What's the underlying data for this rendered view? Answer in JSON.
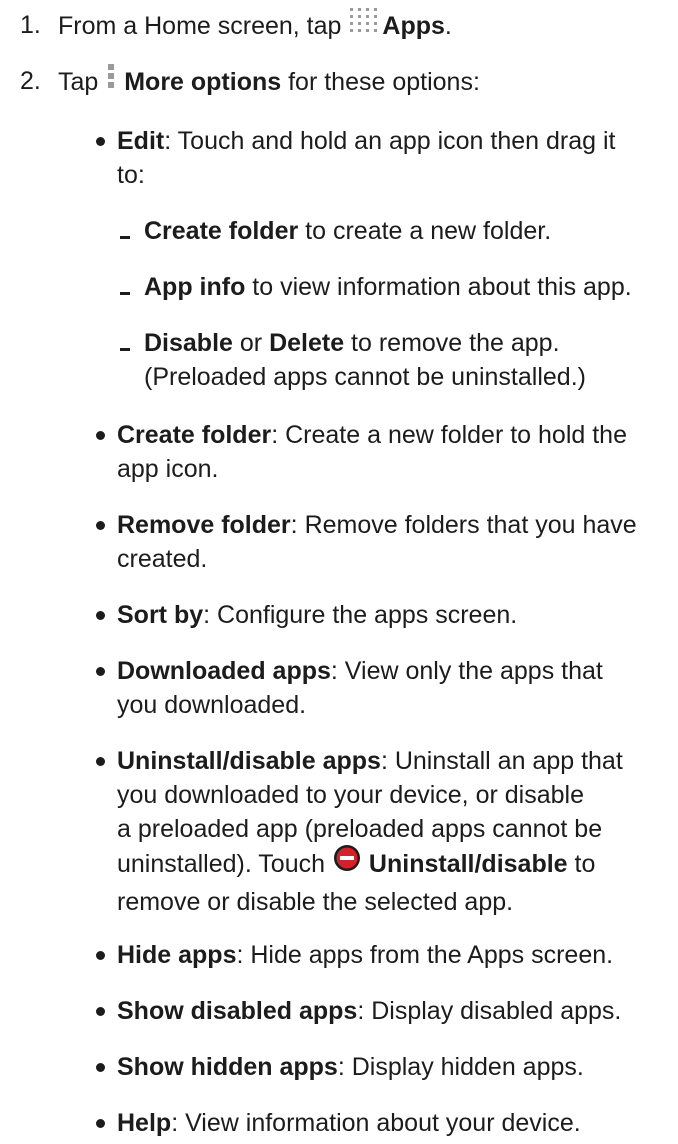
{
  "steps": [
    {
      "num": "1.",
      "pre": "From a Home screen, tap",
      "icon": "apps-grid-icon",
      "bold": "Apps",
      "post": "."
    },
    {
      "num": "2.",
      "pre": "Tap",
      "icon": "more-options-icon",
      "bold": "More options",
      "post": "for these options:"
    }
  ],
  "edit": {
    "term": "Edit",
    "desc": ": Touch and hold an app icon then drag it",
    "desc2": "to:"
  },
  "edit_subs": [
    {
      "term": "Create folder",
      "desc": " to create a new folder."
    },
    {
      "term": "App info",
      "desc": " to view information about this app."
    },
    {
      "term": "Disable",
      "mid": " or ",
      "term2": "Delete",
      "desc": " to remove the app.",
      "desc2": "(Preloaded apps cannot be uninstalled.)"
    }
  ],
  "options": [
    {
      "term": "Create folder",
      "desc": ": Create a new folder to hold the",
      "desc2": "app icon."
    },
    {
      "term": "Remove folder",
      "desc": ": Remove folders that you have",
      "desc2": "created."
    },
    {
      "term": "Sort by",
      "desc": ": Configure the apps screen."
    },
    {
      "term": "Downloaded apps",
      "desc": ": View only the apps that",
      "desc2": "you downloaded."
    }
  ],
  "uninstall": {
    "term": "Uninstall/disable apps",
    "desc": ": Uninstall an app that",
    "line2": "you downloaded to your device, or disable",
    "line3": "a preloaded app (preloaded apps cannot be",
    "line4_pre": "uninstalled). Touch",
    "icon": "uninstall-minus-icon",
    "line4_bold": "Uninstall/disable",
    "line4_post": " to",
    "line5": "remove or disable the selected app."
  },
  "options_tail": [
    {
      "term": "Hide apps",
      "desc": ": Hide apps from the Apps screen."
    },
    {
      "term": "Show disabled apps",
      "desc": ": Display disabled apps."
    },
    {
      "term": "Show hidden apps",
      "desc": ": Display hidden apps."
    },
    {
      "term": "Help",
      "desc": ": View information about your device."
    }
  ],
  "colors": {
    "text": "#1c1c1c",
    "icon_grey": "#9a9a9a",
    "minus_red": "#d3212a"
  }
}
